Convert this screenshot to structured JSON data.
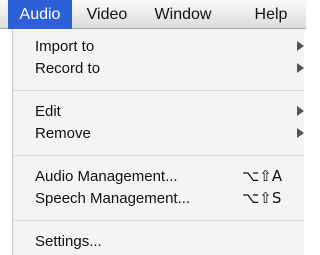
{
  "menubar": {
    "items": [
      {
        "label": "Audio",
        "active": true
      },
      {
        "label": "Video",
        "active": false
      },
      {
        "label": "Window",
        "active": false
      },
      {
        "label": "Help",
        "active": false
      }
    ]
  },
  "dropdown": {
    "groups": [
      [
        {
          "label": "Import to",
          "submenu": true
        },
        {
          "label": "Record to",
          "submenu": true
        }
      ],
      [
        {
          "label": "Edit",
          "submenu": true
        },
        {
          "label": "Remove",
          "submenu": true
        }
      ],
      [
        {
          "label": "Audio Management...",
          "shortcut": "⌥⇧A"
        },
        {
          "label": "Speech Management...",
          "shortcut": "⌥⇧S"
        }
      ],
      [
        {
          "label": "Settings..."
        }
      ]
    ],
    "submenu_icon": "triangle-right-icon"
  },
  "colors": {
    "active_menu_bg": "#2d5fd6",
    "menu_bg": "#f4f4f4"
  }
}
